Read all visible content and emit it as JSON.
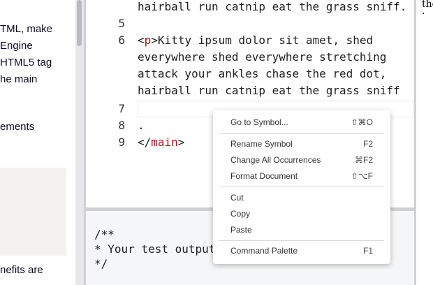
{
  "instructions": {
    "lines": [
      "TML, make",
      "Engine",
      "HTML5 tag",
      "he main",
      "ements",
      "nefits are"
    ]
  },
  "editor": {
    "lines": [
      {
        "num": "",
        "text": "hairball run catnip eat the grass sniff."
      },
      {
        "num": "5",
        "text": ""
      },
      {
        "num": "6",
        "tag_open": "<",
        "tag": "p",
        "tag_close": ">",
        "rest": "Kitty ipsum dolor sit amet, shed"
      },
      {
        "num": "",
        "text": "everywhere shed everywhere stretching"
      },
      {
        "num": "",
        "text": "attack your ankles chase the red dot,"
      },
      {
        "num": "",
        "text": "hairball run catnip eat the grass sniff"
      },
      {
        "num": "7",
        "text": ""
      },
      {
        "num": "8",
        "text": "."
      },
      {
        "num": "9",
        "tag_open": "</",
        "tag": "main",
        "tag_close": ">",
        "rest": ""
      }
    ]
  },
  "console": {
    "lines": [
      "/**",
      "* Your test output",
      "*/"
    ]
  },
  "preview": {
    "lines": [
      "the",
      "."
    ]
  },
  "context_menu": {
    "items": [
      {
        "label": "Go to Symbol...",
        "shortcut": "⇧⌘O"
      },
      {
        "label": "Rename Symbol",
        "shortcut": "F2"
      },
      {
        "label": "Change All Occurrences",
        "shortcut": "⌘F2"
      },
      {
        "label": "Format Document",
        "shortcut": "⇧⌥F"
      },
      {
        "label": "Cut",
        "shortcut": ""
      },
      {
        "label": "Copy",
        "shortcut": ""
      },
      {
        "label": "Paste",
        "shortcut": ""
      },
      {
        "label": "Command Palette",
        "shortcut": "F1"
      }
    ]
  }
}
